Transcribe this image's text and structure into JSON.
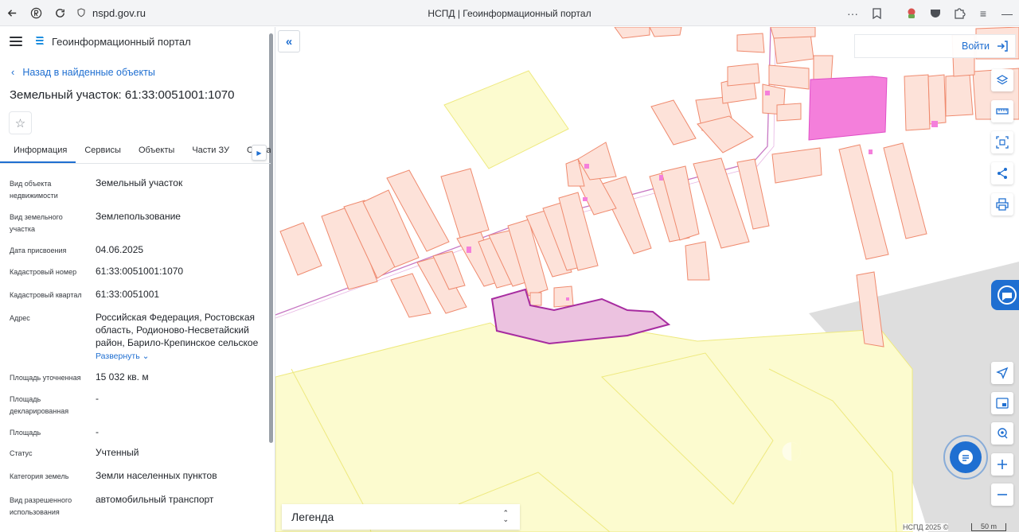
{
  "browser": {
    "url": "nspd.gov.ru",
    "tab_title": "НСПД | Геоинформационный портал"
  },
  "panel": {
    "portal_name": "Геоинформационный портал",
    "back_label": "Назад в найденные объекты",
    "object_title": "Земельный участок: 61:33:0051001:1070",
    "tabs": [
      {
        "label": "Информация",
        "active": true
      },
      {
        "label": "Сервисы"
      },
      {
        "label": "Объекты"
      },
      {
        "label": "Части ЗУ"
      },
      {
        "label": "Соста"
      }
    ],
    "properties": [
      {
        "label": "Вид объекта недвижимости",
        "value": "Земельный участок"
      },
      {
        "label": "Вид земельного участка",
        "value": "Землепользование"
      },
      {
        "label": "Дата присвоения",
        "value": "04.06.2025"
      },
      {
        "label": "Кадастровый номер",
        "value": "61:33:0051001:1070"
      },
      {
        "label": "Кадастровый квартал",
        "value": "61:33:0051001"
      },
      {
        "label": "Адрес",
        "value": "Российская Федерация, Ростовская область, Родионово-Несветайский район, Барило-Крепинское сельское",
        "expand_label": "Развернуть"
      },
      {
        "label": "Площадь уточненная",
        "value": "15 032 кв. м"
      },
      {
        "label": "Площадь декларированная",
        "value": "-"
      },
      {
        "label": "Площадь",
        "value": "-"
      },
      {
        "label": "Статус",
        "value": "Учтенный"
      },
      {
        "label": "Категория земель",
        "value": "Земли населенных пунктов"
      },
      {
        "label": "Вид разрешенного использования",
        "value": "автомобильный транспорт"
      }
    ]
  },
  "map": {
    "login_label": "Войти",
    "legend_label": "Легенда",
    "attribution": "НСПД 2025 ©",
    "scale_label": "50 m",
    "colors": {
      "parcel_fill": "#fde2d9",
      "parcel_stroke": "#ef8a6e",
      "zone_fill": "#fcfbcf",
      "zone_stroke": "#eee97f",
      "selected_fill": "#ecc2e0",
      "selected_stroke": "#a72ca0",
      "magenta": "#f47fdb",
      "road": "#dedede",
      "accent": "#1f6fd1"
    },
    "tools_top": [
      "layers-icon",
      "ruler-icon",
      "select-area-icon",
      "share-icon",
      "print-icon"
    ],
    "tools_bottom": [
      "locate-icon",
      "minimap-icon",
      "pin-icon",
      "zoom-in-icon",
      "zoom-out-icon"
    ]
  }
}
